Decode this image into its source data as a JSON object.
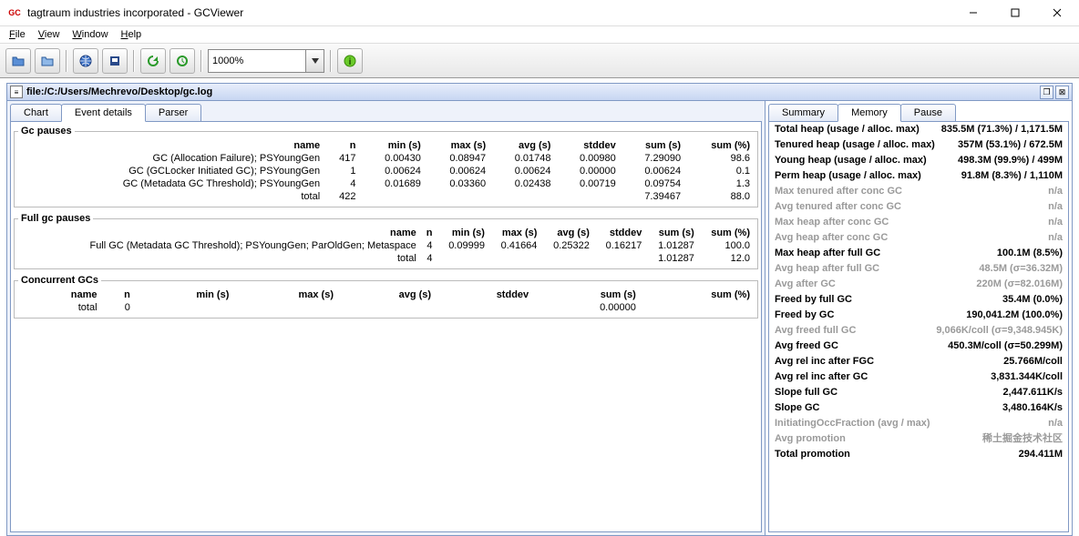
{
  "titlebar": {
    "icon_top": "GC",
    "icon_bot": "VIEWER",
    "text": "tagtraum industries incorporated - GCViewer"
  },
  "menubar": [
    {
      "letter": "F",
      "rest": "ile"
    },
    {
      "letter": "V",
      "rest": "iew"
    },
    {
      "letter": "W",
      "rest": "indow"
    },
    {
      "letter": "H",
      "rest": "elp"
    }
  ],
  "toolbar": {
    "zoom": "1000%"
  },
  "internal_frame": {
    "title": "file:/C:/Users/Mechrevo/Desktop/gc.log"
  },
  "left_tabs": [
    "Chart",
    "Event details",
    "Parser"
  ],
  "active_left_tab": 1,
  "gc_pauses": {
    "legend": "Gc pauses",
    "headers": [
      "name",
      "n",
      "min (s)",
      "max (s)",
      "avg (s)",
      "stddev",
      "sum (s)",
      "sum (%)"
    ],
    "rows": [
      {
        "name": "GC (Allocation Failure); PSYoungGen",
        "n": "417",
        "min": "0.00430",
        "max": "0.08947",
        "avg": "0.01748",
        "std": "0.00980",
        "sum": "7.29090",
        "pct": "98.6"
      },
      {
        "name": "GC (GCLocker Initiated GC); PSYoungGen",
        "n": "1",
        "min": "0.00624",
        "max": "0.00624",
        "avg": "0.00624",
        "std": "0.00000",
        "sum": "0.00624",
        "pct": "0.1"
      },
      {
        "name": "GC (Metadata GC Threshold); PSYoungGen",
        "n": "4",
        "min": "0.01689",
        "max": "0.03360",
        "avg": "0.02438",
        "std": "0.00719",
        "sum": "0.09754",
        "pct": "1.3"
      }
    ],
    "total": {
      "name": "total",
      "n": "422",
      "sum": "7.39467",
      "pct": "88.0"
    }
  },
  "full_gc": {
    "legend": "Full gc pauses",
    "headers": [
      "name",
      "n",
      "min (s)",
      "max (s)",
      "avg (s)",
      "stddev",
      "sum (s)",
      "sum (%)"
    ],
    "rows": [
      {
        "name": "Full GC (Metadata GC Threshold); PSYoungGen; ParOldGen; Metaspace",
        "n": "4",
        "min": "0.09999",
        "max": "0.41664",
        "avg": "0.25322",
        "std": "0.16217",
        "sum": "1.01287",
        "pct": "100.0"
      }
    ],
    "total": {
      "name": "total",
      "n": "4",
      "sum": "1.01287",
      "pct": "12.0"
    }
  },
  "concurrent": {
    "legend": "Concurrent GCs",
    "headers": [
      "name",
      "n",
      "min (s)",
      "max (s)",
      "avg (s)",
      "stddev",
      "sum (s)",
      "sum (%)"
    ],
    "total": {
      "name": "total",
      "n": "0",
      "sum": "0.00000"
    }
  },
  "right_tabs": [
    "Summary",
    "Memory",
    "Pause"
  ],
  "active_right_tab": 1,
  "memory": [
    {
      "lbl": "Total heap (usage / alloc. max)",
      "val": "835.5M (71.3%) / 1,171.5M",
      "dim": false
    },
    {
      "lbl": "Tenured heap (usage / alloc. max)",
      "val": "357M (53.1%) / 672.5M",
      "dim": false
    },
    {
      "lbl": "Young heap (usage / alloc. max)",
      "val": "498.3M (99.9%) / 499M",
      "dim": false
    },
    {
      "lbl": "Perm heap (usage / alloc. max)",
      "val": "91.8M (8.3%) / 1,110M",
      "dim": false
    },
    {
      "lbl": "Max tenured after conc GC",
      "val": "n/a",
      "dim": true
    },
    {
      "lbl": "Avg tenured after conc GC",
      "val": "n/a",
      "dim": true
    },
    {
      "lbl": "Max heap after conc GC",
      "val": "n/a",
      "dim": true
    },
    {
      "lbl": "Avg heap after conc GC",
      "val": "n/a",
      "dim": true
    },
    {
      "lbl": "Max heap after full GC",
      "val": "100.1M (8.5%)",
      "dim": false
    },
    {
      "lbl": "Avg heap after full GC",
      "val": "48.5M (σ=36.32M)",
      "dim": true
    },
    {
      "lbl": "Avg after GC",
      "val": "220M (σ=82.016M)",
      "dim": true
    },
    {
      "lbl": "Freed by full GC",
      "val": "35.4M (0.0%)",
      "dim": false
    },
    {
      "lbl": "Freed by GC",
      "val": "190,041.2M (100.0%)",
      "dim": false
    },
    {
      "lbl": "Avg freed full GC",
      "val": "9,066K/coll (σ=9,348.945K)",
      "dim": true
    },
    {
      "lbl": "Avg freed GC",
      "val": "450.3M/coll (σ=50.299M)",
      "dim": false
    },
    {
      "lbl": "Avg rel inc after FGC",
      "val": "25.766M/coll",
      "dim": false
    },
    {
      "lbl": "Avg rel inc after GC",
      "val": "3,831.344K/coll",
      "dim": false
    },
    {
      "lbl": "Slope full GC",
      "val": "2,447.611K/s",
      "dim": false
    },
    {
      "lbl": "Slope GC",
      "val": "3,480.164K/s",
      "dim": false
    },
    {
      "lbl": "InitiatingOccFraction (avg / max)",
      "val": "n/a",
      "dim": true
    },
    {
      "lbl": "Avg promotion",
      "val": "稀土掘金技术社区",
      "dim": true
    },
    {
      "lbl": "Total promotion",
      "val": "294.411M",
      "dim": false
    }
  ]
}
